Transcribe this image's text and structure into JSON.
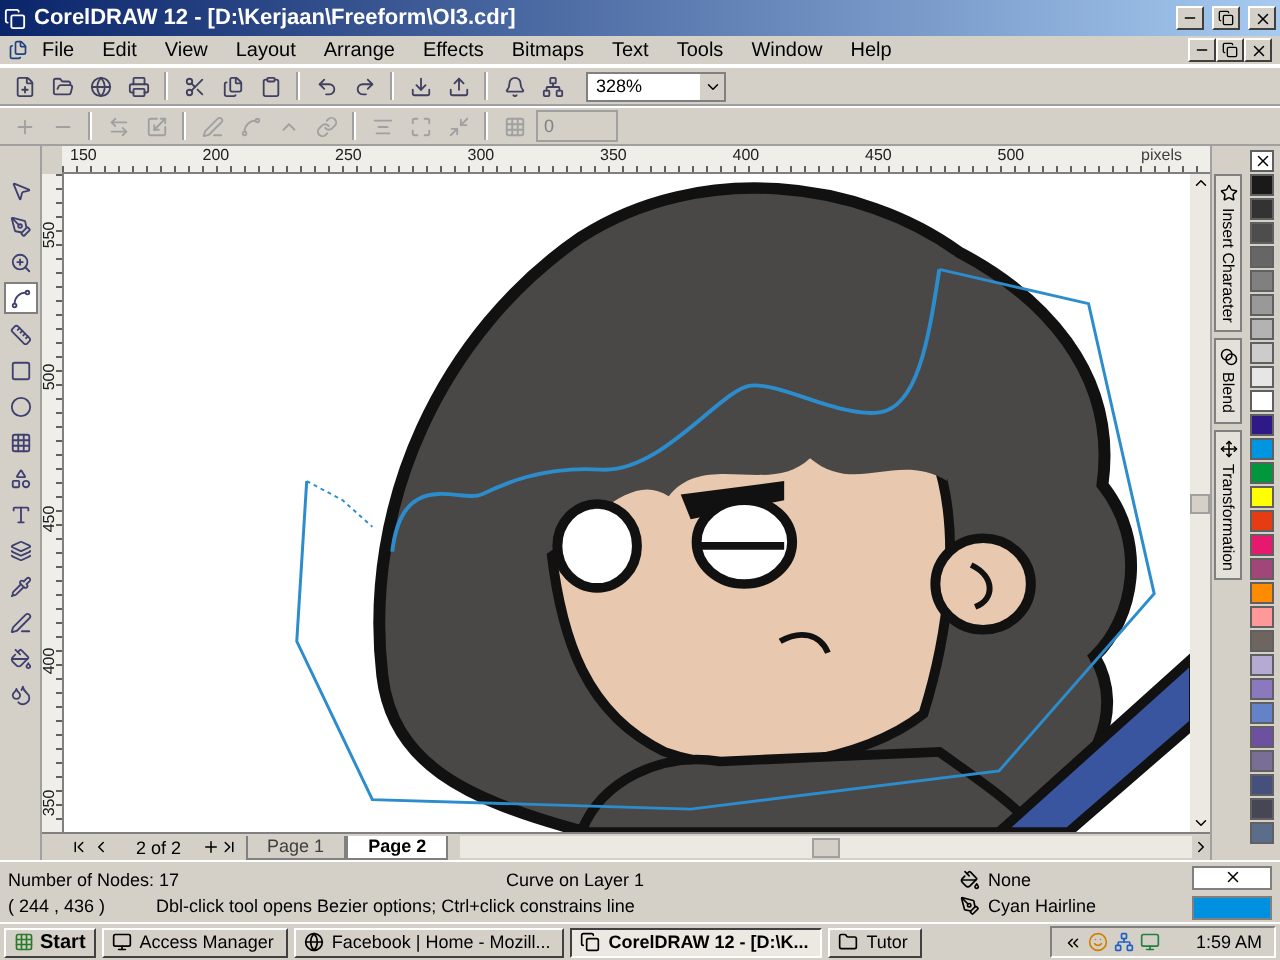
{
  "window": {
    "title": "CorelDRAW 12 - [D:\\Kerjaan\\Freeform\\OI3.cdr]"
  },
  "menu": {
    "items": [
      "File",
      "Edit",
      "View",
      "Layout",
      "Arrange",
      "Effects",
      "Bitmaps",
      "Text",
      "Tools",
      "Window",
      "Help"
    ]
  },
  "toolbar": {
    "zoom": "328%"
  },
  "property_bar": {
    "field_value": "0"
  },
  "rulers": {
    "horizontal": [
      "150",
      "200",
      "250",
      "300",
      "350",
      "400",
      "450",
      "500"
    ],
    "unit": "pixels",
    "vertical": [
      "550",
      "500",
      "450",
      "400",
      "350"
    ]
  },
  "toolbox": {
    "tools": [
      {
        "kind": "pointer",
        "selected": false
      },
      {
        "kind": "shape",
        "selected": false
      },
      {
        "kind": "zoom",
        "selected": false
      },
      {
        "kind": "bezier",
        "selected": true
      },
      {
        "kind": "dimension",
        "selected": false
      },
      {
        "kind": "rectangle",
        "selected": false
      },
      {
        "kind": "ellipse",
        "selected": false
      },
      {
        "kind": "grid",
        "selected": false
      },
      {
        "kind": "shapes",
        "selected": false
      },
      {
        "kind": "text",
        "selected": false
      },
      {
        "kind": "interactive",
        "selected": false
      },
      {
        "kind": "eyedropper",
        "selected": false
      },
      {
        "kind": "outline",
        "selected": false
      },
      {
        "kind": "fill",
        "selected": false
      },
      {
        "kind": "interactive_fill",
        "selected": false
      }
    ]
  },
  "page_nav": {
    "count": "2 of 2",
    "pages": [
      {
        "label": "Page 1",
        "selected": false
      },
      {
        "label": "Page 2",
        "selected": true
      }
    ]
  },
  "dockers": {
    "tabs": [
      "Insert Character",
      "Blend",
      "Transformation"
    ]
  },
  "palette": {
    "colors": [
      {
        "color": "#1a1a1a"
      },
      {
        "color": "#333333"
      },
      {
        "color": "#4d4d4d"
      },
      {
        "color": "#666666"
      },
      {
        "color": "#808080"
      },
      {
        "color": "#999999"
      },
      {
        "color": "#b3b3b3"
      },
      {
        "color": "#cccccc"
      },
      {
        "color": "#e6e6e6"
      },
      {
        "color": "#ffffff"
      },
      {
        "color": "#2e1a87"
      },
      {
        "color": "#0095e0"
      },
      {
        "color": "#00963c"
      },
      {
        "color": "#ffff00"
      },
      {
        "color": "#e63c14"
      },
      {
        "color": "#e6196e"
      },
      {
        "color": "#a04678"
      },
      {
        "color": "#ff8c00"
      },
      {
        "color": "#ff9999"
      },
      {
        "color": "#6e6460"
      },
      {
        "color": "#b4aad2"
      },
      {
        "color": "#8c78be"
      },
      {
        "color": "#6482c8"
      },
      {
        "color": "#6e50a0"
      },
      {
        "color": "#786e96"
      },
      {
        "color": "#46507d"
      },
      {
        "color": "#464655"
      },
      {
        "color": "#5a6e8c"
      }
    ]
  },
  "status_bar": {
    "nodes": "Number of Nodes: 17",
    "object": "Curve on Layer 1",
    "coords": "( 244 , 436 )",
    "hint": "Dbl-click tool opens Bezier options; Ctrl+click constrains line",
    "fill": "None",
    "outline": "Cyan Hairline",
    "outline_swatch": {
      "color": "#0090e0"
    }
  },
  "taskbar": {
    "start": "Start",
    "tasks": [
      {
        "label": "Access Manager",
        "kind": "app",
        "selected": false
      },
      {
        "label": "Facebook | Home - Mozill...",
        "kind": "browser",
        "selected": false
      },
      {
        "label": "CorelDRAW 12 - [D:\\K...",
        "kind": "corel",
        "selected": true
      },
      {
        "label": "Tutor",
        "kind": "folder",
        "selected": false
      }
    ],
    "clock": "1:59 AM"
  }
}
